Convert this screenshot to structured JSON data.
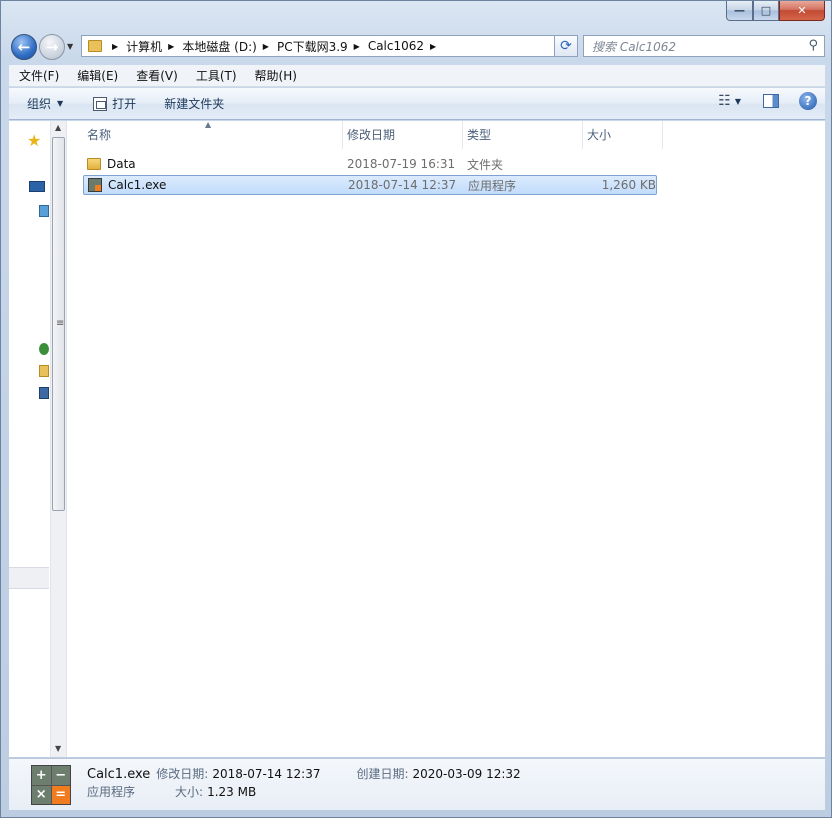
{
  "window": {
    "minimize_glyph": "—",
    "maximize_glyph": "□",
    "close_glyph": "✕"
  },
  "nav": {
    "back_glyph": "←",
    "forward_glyph": "→",
    "breadcrumbs": [
      "计算机",
      "本地磁盘 (D:)",
      "PC下载网3.9",
      "Calc1062"
    ],
    "search_placeholder": "搜索 Calc1062"
  },
  "menu": [
    "文件(F)",
    "编辑(E)",
    "查看(V)",
    "工具(T)",
    "帮助(H)"
  ],
  "toolbar": {
    "organize_label": "组织",
    "open_label": "打开",
    "new_folder_label": "新建文件夹"
  },
  "columns": {
    "name": "名称",
    "date": "修改日期",
    "type": "类型",
    "size": "大小"
  },
  "files": [
    {
      "name": "Data",
      "date": "2018-07-19 16:31",
      "type": "文件夹",
      "size": "",
      "kind": "folder-icon"
    },
    {
      "name": "Calc1.exe",
      "date": "2018-07-14 12:37",
      "type": "应用程序",
      "size": "1,260 KB",
      "kind": "exe-icon"
    }
  ],
  "details": {
    "name": "Calc1.exe",
    "modified_label": "修改日期:",
    "modified_value": "2018-07-14 12:37",
    "created_label": "创建日期:",
    "created_value": "2020-03-09 12:32",
    "type_value": "应用程序",
    "size_label": "大小:",
    "size_value": "1.23 MB",
    "icon_glyphs": [
      "+",
      "−",
      "×",
      "="
    ]
  },
  "colors": {
    "accent": "#2f6dc4",
    "selection": "#c1dcfc",
    "calc_orange": "#f07c1f"
  }
}
